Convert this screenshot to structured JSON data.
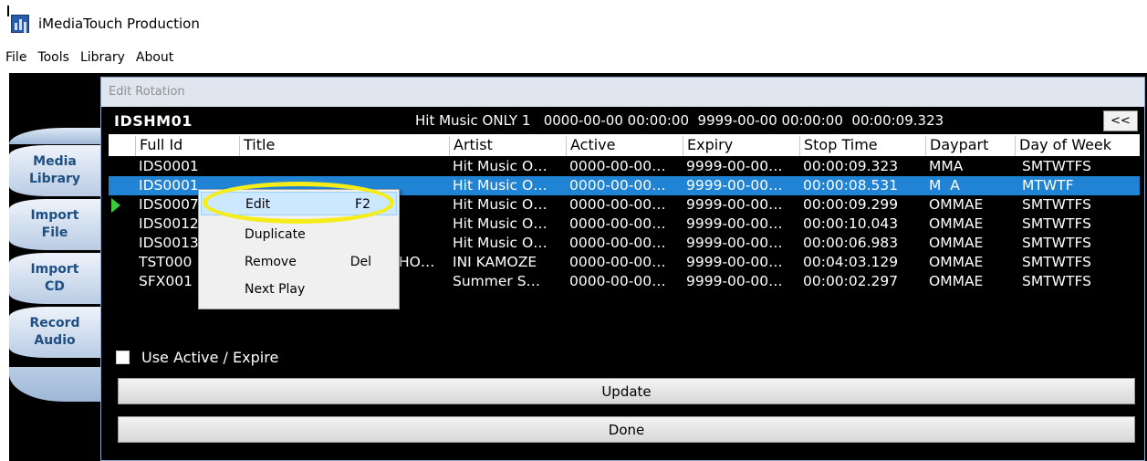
{
  "window": {
    "title": "iMediaTouch Production"
  },
  "menubar": [
    "File",
    "Tools",
    "Library",
    "About"
  ],
  "sidebar": {
    "items": [
      {
        "label": "Media\nLibrary"
      },
      {
        "label": "Import\nFile"
      },
      {
        "label": "Import\nCD"
      },
      {
        "label": "Record\nAudio"
      }
    ]
  },
  "dialog": {
    "title": "Edit Rotation",
    "header": {
      "id": "IDSHM01",
      "info": "Hit Music ONLY 1   0000-00-00 00:00:00  9999-00-00 00:00:00  00:00:09.323",
      "collapse_label": "<<"
    },
    "columns": [
      "Full Id",
      "Title",
      "Artist",
      "Active",
      "Expiry",
      "Stop Time",
      "Daypart",
      "Day of Week"
    ],
    "rows": [
      {
        "full_id": "IDS0001",
        "title": "",
        "artist": "Hit Music O…",
        "active": "0000-00-00…",
        "expiry": "9999-00-00…",
        "stop_time": "00:00:09.323",
        "daypart": "MMA",
        "dow": "SMTWTFS",
        "selected": false,
        "playing": false
      },
      {
        "full_id": "IDS0001",
        "title": "",
        "artist": "Hit Music O…",
        "active": "0000-00-00…",
        "expiry": "9999-00-00…",
        "stop_time": "00:00:08.531",
        "daypart": "M  A",
        "dow": "MTWTF",
        "selected": true,
        "playing": false
      },
      {
        "full_id": "IDS0007",
        "title": "",
        "artist": "Hit Music O…",
        "active": "0000-00-00…",
        "expiry": "9999-00-00…",
        "stop_time": "00:00:09.299",
        "daypart": "OMMAE",
        "dow": "SMTWTFS",
        "selected": false,
        "playing": true
      },
      {
        "full_id": "IDS0012",
        "title": "",
        "artist": "Hit Music O…",
        "active": "0000-00-00…",
        "expiry": "9999-00-00…",
        "stop_time": "00:00:10.043",
        "daypart": "OMMAE",
        "dow": "SMTWTFS",
        "selected": false,
        "playing": false
      },
      {
        "full_id": "IDS0013",
        "title": "",
        "artist": "Hit Music O…",
        "active": "0000-00-00…",
        "expiry": "9999-00-00…",
        "stop_time": "00:00:06.983",
        "daypart": "OMMAE",
        "dow": "SMTWTFS",
        "selected": false,
        "playing": false
      },
      {
        "full_id": "TST000",
        "title": "HO…",
        "artist": "INI KAMOZE",
        "active": "0000-00-00…",
        "expiry": "9999-00-00…",
        "stop_time": "00:04:03.129",
        "daypart": "OMMAE",
        "dow": "SMTWTFS",
        "selected": false,
        "playing": false
      },
      {
        "full_id": "SFX001",
        "title": "",
        "artist": "Summer S…",
        "active": "0000-00-00…",
        "expiry": "9999-00-00…",
        "stop_time": "00:00:02.297",
        "daypart": "OMMAE",
        "dow": "SMTWTFS",
        "selected": false,
        "playing": false
      }
    ],
    "use_active_expire": {
      "label": "Use Active / Expire",
      "checked": false
    },
    "update_label": "Update",
    "done_label": "Done"
  },
  "context_menu": {
    "items": [
      {
        "label": "Edit",
        "shortcut": "F2",
        "highlighted": true
      },
      {
        "label": "Duplicate",
        "shortcut": "",
        "highlighted": false
      },
      {
        "label": "Remove",
        "shortcut": "Del",
        "highlighted": false
      },
      {
        "label": "Next Play",
        "shortcut": "",
        "highlighted": false
      }
    ]
  },
  "colors": {
    "selection": "#2083d3",
    "annotation": "#f5ec18",
    "play_marker": "#3ec93e",
    "nav_text": "#1f4f82"
  }
}
